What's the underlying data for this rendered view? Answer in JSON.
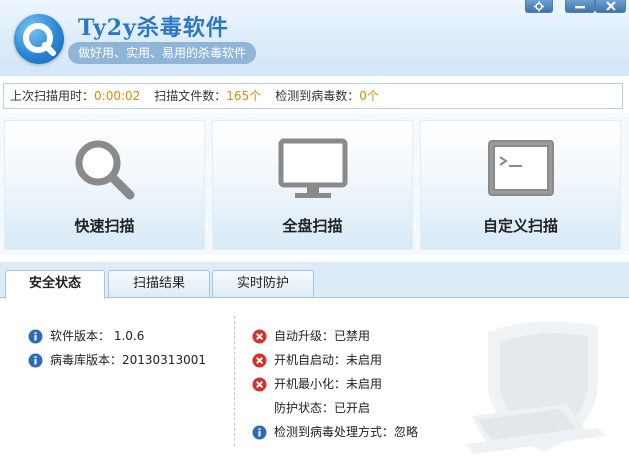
{
  "app": {
    "title": "Ty2y杀毒软件",
    "slogan": "做好用、实用、易用的杀毒软件"
  },
  "window_buttons": [
    {
      "name": "settings-button",
      "icon": "gear-icon"
    },
    {
      "name": "minimize-button",
      "icon": "minimize-icon"
    },
    {
      "name": "close-button",
      "icon": "close-icon"
    }
  ],
  "stats": {
    "last_scan_label": "上次扫描用时：",
    "last_scan_value": "0:00:02",
    "files_label": "扫描文件数：",
    "files_value": "165个",
    "virus_label": "检测到病毒数：",
    "virus_value": "0个"
  },
  "scan_buttons": [
    {
      "label": "快速扫描",
      "icon": "magnifier-icon"
    },
    {
      "label": "全盘扫描",
      "icon": "monitor-icon"
    },
    {
      "label": "自定义扫描",
      "icon": "terminal-icon"
    }
  ],
  "tabs": [
    {
      "label": "安全状态",
      "active": true
    },
    {
      "label": "扫描结果",
      "active": false
    },
    {
      "label": "实时防护",
      "active": false
    }
  ],
  "info_left": [
    {
      "icon": "info-icon",
      "text": "软件版本： 1.0.6"
    },
    {
      "icon": "info-icon",
      "text": "病毒库版本：20130313001"
    }
  ],
  "info_right": [
    {
      "icon": "error-icon",
      "text": "自动升级：已禁用"
    },
    {
      "icon": "error-icon",
      "text": "开机自启动：未启用"
    },
    {
      "icon": "error-icon",
      "text": "开机最小化：未启用"
    },
    {
      "icon": "",
      "text": "防护状态：已开启"
    },
    {
      "icon": "info-icon",
      "text": "检测到病毒处理方式：忽略"
    }
  ],
  "colors": {
    "accent": "#2b78c2",
    "value_orange": "#e08a00",
    "error_red": "#d9302c",
    "info_blue": "#2f6db3"
  }
}
